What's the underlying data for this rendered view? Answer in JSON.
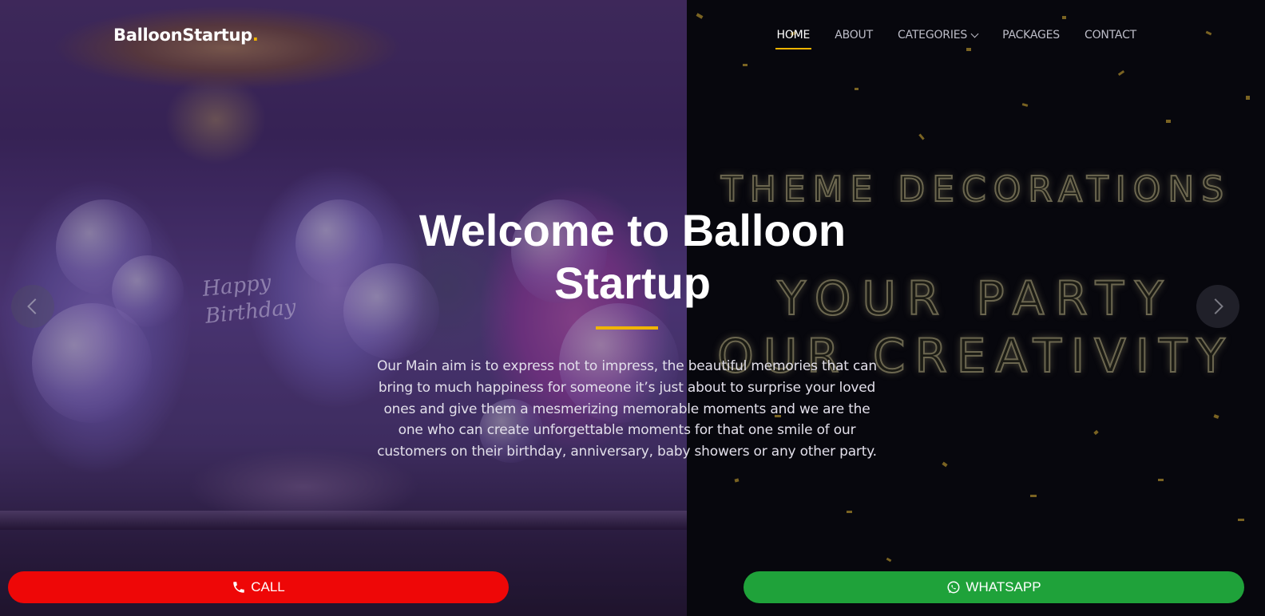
{
  "header": {
    "brand": "BalloonStartup",
    "brand_dot": ".",
    "nav": [
      {
        "label": "HOME",
        "active": true
      },
      {
        "label": "ABOUT"
      },
      {
        "label": "CATEGORIES",
        "has_dropdown": true
      },
      {
        "label": "PACKAGES"
      },
      {
        "label": "CONTACT"
      }
    ]
  },
  "hero": {
    "title_line1": "Welcome to Balloon",
    "title_line2": "Startup",
    "description": "Our Main aim is to express not to impress, the beautiful memories that can bring to much happiness for someone it’s just about to surprise your loved ones and give them a mesmerizing memorable moments and we are the one who can create unforgettable moments for that one smile of our customers on their birthday, anniversary, baby showers or any other party.",
    "slide_image_text": {
      "neon_line1": "Happy",
      "neon_line2": "Birthday",
      "banner_line1": "THEME DECORATIONS",
      "banner_line2": "YOUR PARTY",
      "banner_line3": "OUR CREATIVITY"
    }
  },
  "carousel": {
    "prev_icon": "chevron-left-icon",
    "next_icon": "chevron-right-icon"
  },
  "actions": {
    "call_label": "CALL",
    "call_icon": "phone-icon",
    "whatsapp_label": "WHATSAPP",
    "whatsapp_icon": "whatsapp-icon"
  },
  "colors": {
    "accent": "#f0b400",
    "call_button": "#ee0707",
    "whatsapp_button": "#1fa23a"
  }
}
